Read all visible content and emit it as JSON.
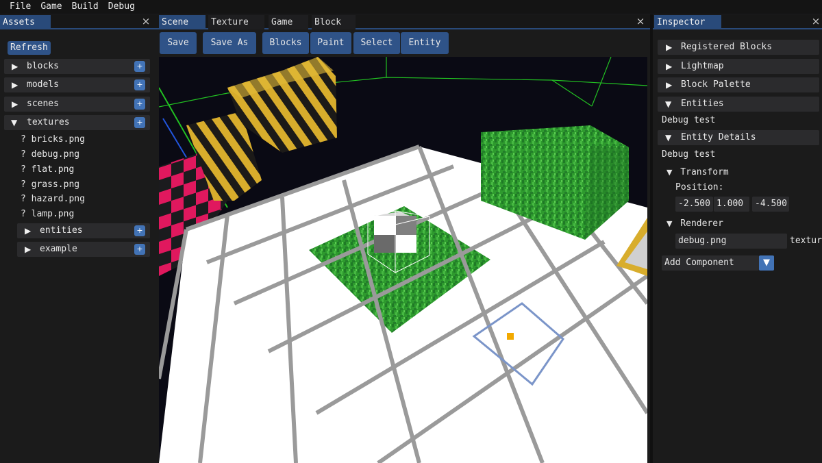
{
  "menu": [
    "File",
    "Game",
    "Build",
    "Debug"
  ],
  "assets": {
    "title": "Assets",
    "close": "×",
    "refresh": "Refresh",
    "folders": [
      {
        "label": "blocks",
        "expanded": false
      },
      {
        "label": "models",
        "expanded": false
      },
      {
        "label": "scenes",
        "expanded": false
      },
      {
        "label": "textures",
        "expanded": true
      }
    ],
    "files": [
      "? bricks.png",
      "? debug.png",
      "? flat.png",
      "? grass.png",
      "? hazard.png",
      "? lamp.png"
    ],
    "subfolders": [
      {
        "label": "entities",
        "expanded": false
      },
      {
        "label": "example",
        "expanded": false
      }
    ],
    "plus": "+"
  },
  "center": {
    "tabs": [
      "Scene",
      "Texture",
      "Game",
      "Block"
    ],
    "close": "×",
    "toolbar": [
      "Save",
      "Save As",
      "Blocks",
      "Paint",
      "Select",
      "Entity"
    ]
  },
  "inspector": {
    "title": "Inspector",
    "close": "×",
    "sections": [
      "Registered Blocks",
      "Lightmap",
      "Block Palette",
      "Entities"
    ],
    "entities_item": "Debug test",
    "entity_details": "Entity Details",
    "entity_name": "Debug test",
    "transform": "Transform",
    "position_label": "Position:",
    "position": [
      "-2.500",
      "1.000",
      "-4.500"
    ],
    "renderer": "Renderer",
    "texture_value": "debug.png",
    "texture_label": "texture",
    "add_component": "Add Component"
  },
  "colors": {
    "accent": "#294a7a",
    "button": "#2f5388",
    "plus": "#4273b6",
    "grass": "#2e9a2e",
    "hazard_yellow": "#d8ad2c",
    "pink": "#e0185e",
    "grid_line": "#9a9a9a",
    "tile": "#ffffff"
  },
  "icons": {
    "collapsed": "triangle-right-icon",
    "expanded": "triangle-down-icon",
    "close": "close-icon",
    "add": "plus-icon",
    "dropdown": "chevron-down-icon"
  }
}
